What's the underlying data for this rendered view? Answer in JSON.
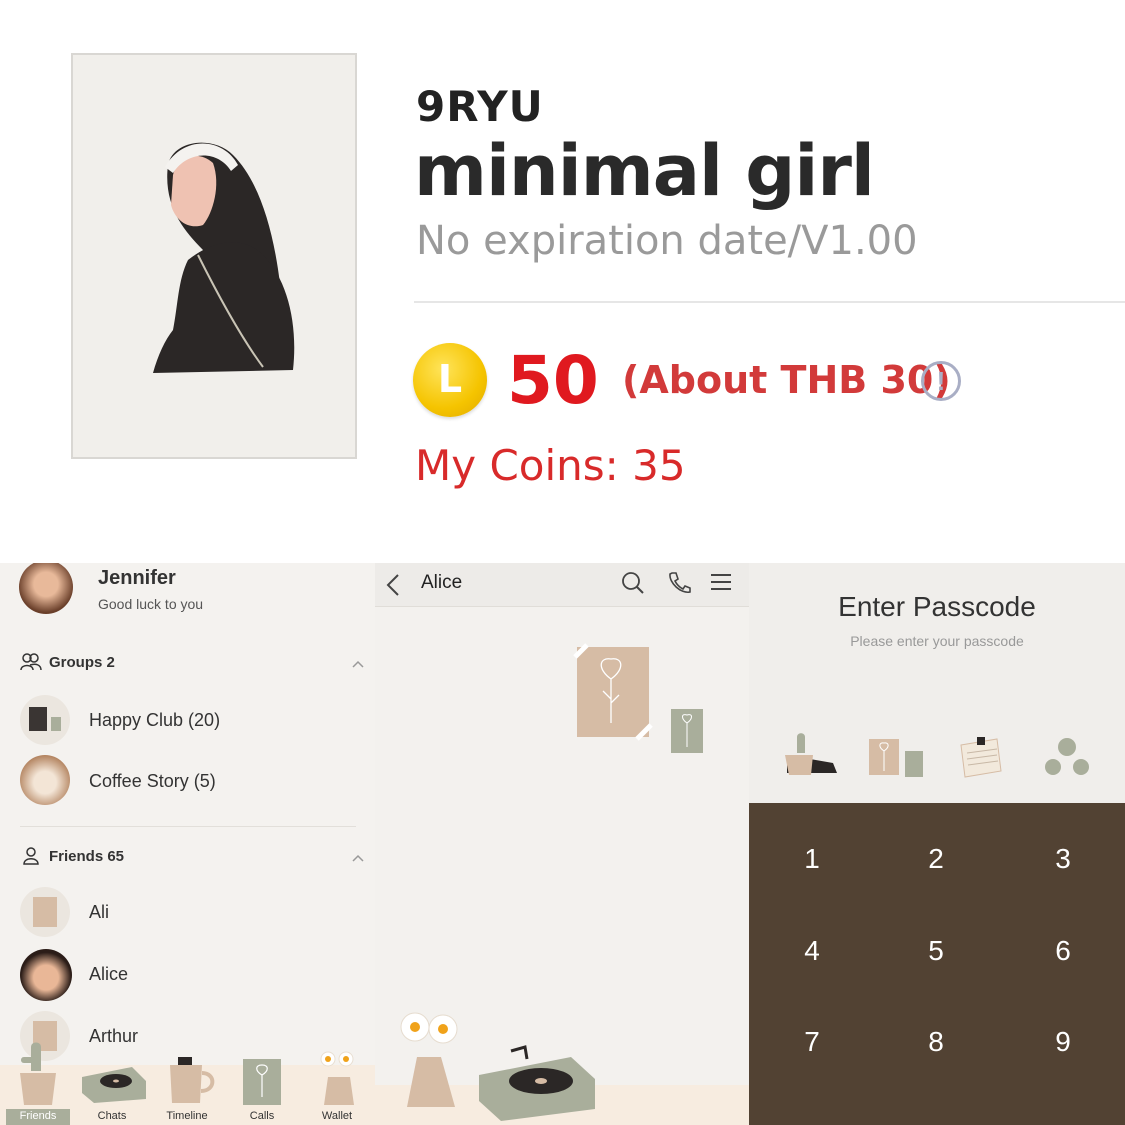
{
  "listing": {
    "author": "9RYU",
    "title": "minimal girl",
    "subtitle": "No expiration date/V1.00",
    "coin_letter": "L",
    "price": "50",
    "price_approx": "(About THB 30)",
    "info_glyph": "!",
    "my_coins": "My Coins: 35"
  },
  "friends_screen": {
    "profile": {
      "name": "Jennifer",
      "status": "Good luck to you"
    },
    "groups_label": "Groups 2",
    "groups": [
      {
        "name": "Happy Club (20)"
      },
      {
        "name": "Coffee Story (5)"
      }
    ],
    "friends_label": "Friends 65",
    "friends": [
      {
        "name": "Ali"
      },
      {
        "name": "Alice"
      },
      {
        "name": "Arthur"
      }
    ],
    "tabs": [
      {
        "label": "Friends",
        "icon": "cactus-pot-icon"
      },
      {
        "label": "Chats",
        "icon": "record-player-icon"
      },
      {
        "label": "Timeline",
        "icon": "mug-icon"
      },
      {
        "label": "Calls",
        "icon": "flower-card-icon"
      },
      {
        "label": "Wallet",
        "icon": "flower-vase-icon"
      }
    ]
  },
  "chat_screen": {
    "contact_name": "Alice",
    "back_icon": "back-chevron-icon",
    "search_icon": "search-icon",
    "call_icon": "phone-icon",
    "menu_icon": "menu-icon"
  },
  "passcode_screen": {
    "title": "Enter Passcode",
    "subtitle": "Please enter your passcode",
    "keys": [
      "1",
      "2",
      "3",
      "4",
      "5",
      "6",
      "7",
      "8",
      "9"
    ]
  },
  "colors": {
    "price_red": "#e0191f",
    "coin_yellow": "#f5c400",
    "keypad_brown": "#524233",
    "beige": "#d6bca5",
    "sage": "#a9ae9b"
  }
}
